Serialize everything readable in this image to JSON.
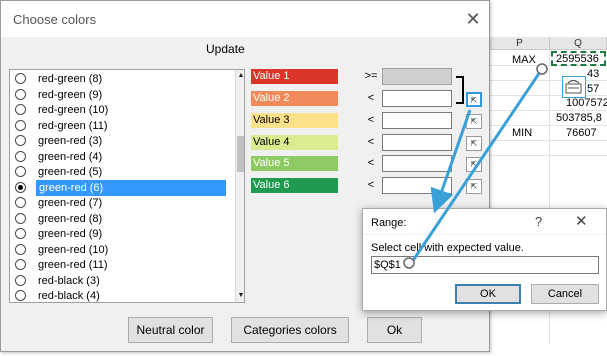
{
  "spreadsheet": {
    "columns": [
      "P",
      "Q"
    ],
    "labels": {
      "max": "MAX",
      "min": "MIN"
    },
    "q_values": [
      "2595536",
      "43",
      "57",
      "1007572",
      "503785,8",
      "76607"
    ]
  },
  "dialog": {
    "title": "Choose colors",
    "close_glyph": "✕",
    "update_label": "Update",
    "list_items": [
      {
        "label": "red-green (8)",
        "selected": false
      },
      {
        "label": "red-green (9)",
        "selected": false
      },
      {
        "label": "red-green (10)",
        "selected": false
      },
      {
        "label": "red-green (11)",
        "selected": false
      },
      {
        "label": "green-red (3)",
        "selected": false
      },
      {
        "label": "green-red (4)",
        "selected": false
      },
      {
        "label": "green-red (5)",
        "selected": false
      },
      {
        "label": "green-red (6)",
        "selected": true
      },
      {
        "label": "green-red (7)",
        "selected": false
      },
      {
        "label": "green-red (8)",
        "selected": false
      },
      {
        "label": "green-red (9)",
        "selected": false
      },
      {
        "label": "green-red (10)",
        "selected": false
      },
      {
        "label": "green-red (11)",
        "selected": false
      },
      {
        "label": "red-black (3)",
        "selected": false
      },
      {
        "label": "red-black (4)",
        "selected": false
      }
    ],
    "values": [
      {
        "label": "Value 1",
        "color": "#d9352b",
        "text_color": "#ffffff",
        "op": ">="
      },
      {
        "label": "Value 2",
        "color": "#f08a5a",
        "text_color": "#ffffff",
        "op": "<"
      },
      {
        "label": "Value 3",
        "color": "#fde08a",
        "text_color": "#000000",
        "op": "<"
      },
      {
        "label": "Value 4",
        "color": "#d8ec90",
        "text_color": "#000000",
        "op": "<"
      },
      {
        "label": "Value 5",
        "color": "#8fcb64",
        "text_color": "#ffffff",
        "op": "<"
      },
      {
        "label": "Value 6",
        "color": "#1f9a4f",
        "text_color": "#ffffff",
        "op": "<"
      }
    ],
    "buttons": {
      "neutral": "Neutral color",
      "categories": "Categories colors",
      "ok": "Ok"
    }
  },
  "range_dialog": {
    "title": "Range:",
    "help_glyph": "?",
    "close_glyph": "✕",
    "prompt": "Select cell with expected value.",
    "input_value": "$Q$1",
    "ok": "OK",
    "cancel": "Cancel"
  },
  "colors": {
    "selection": "#3399ff",
    "arrow": "#3aa0d8",
    "highlight_border": "#1f7a44"
  }
}
